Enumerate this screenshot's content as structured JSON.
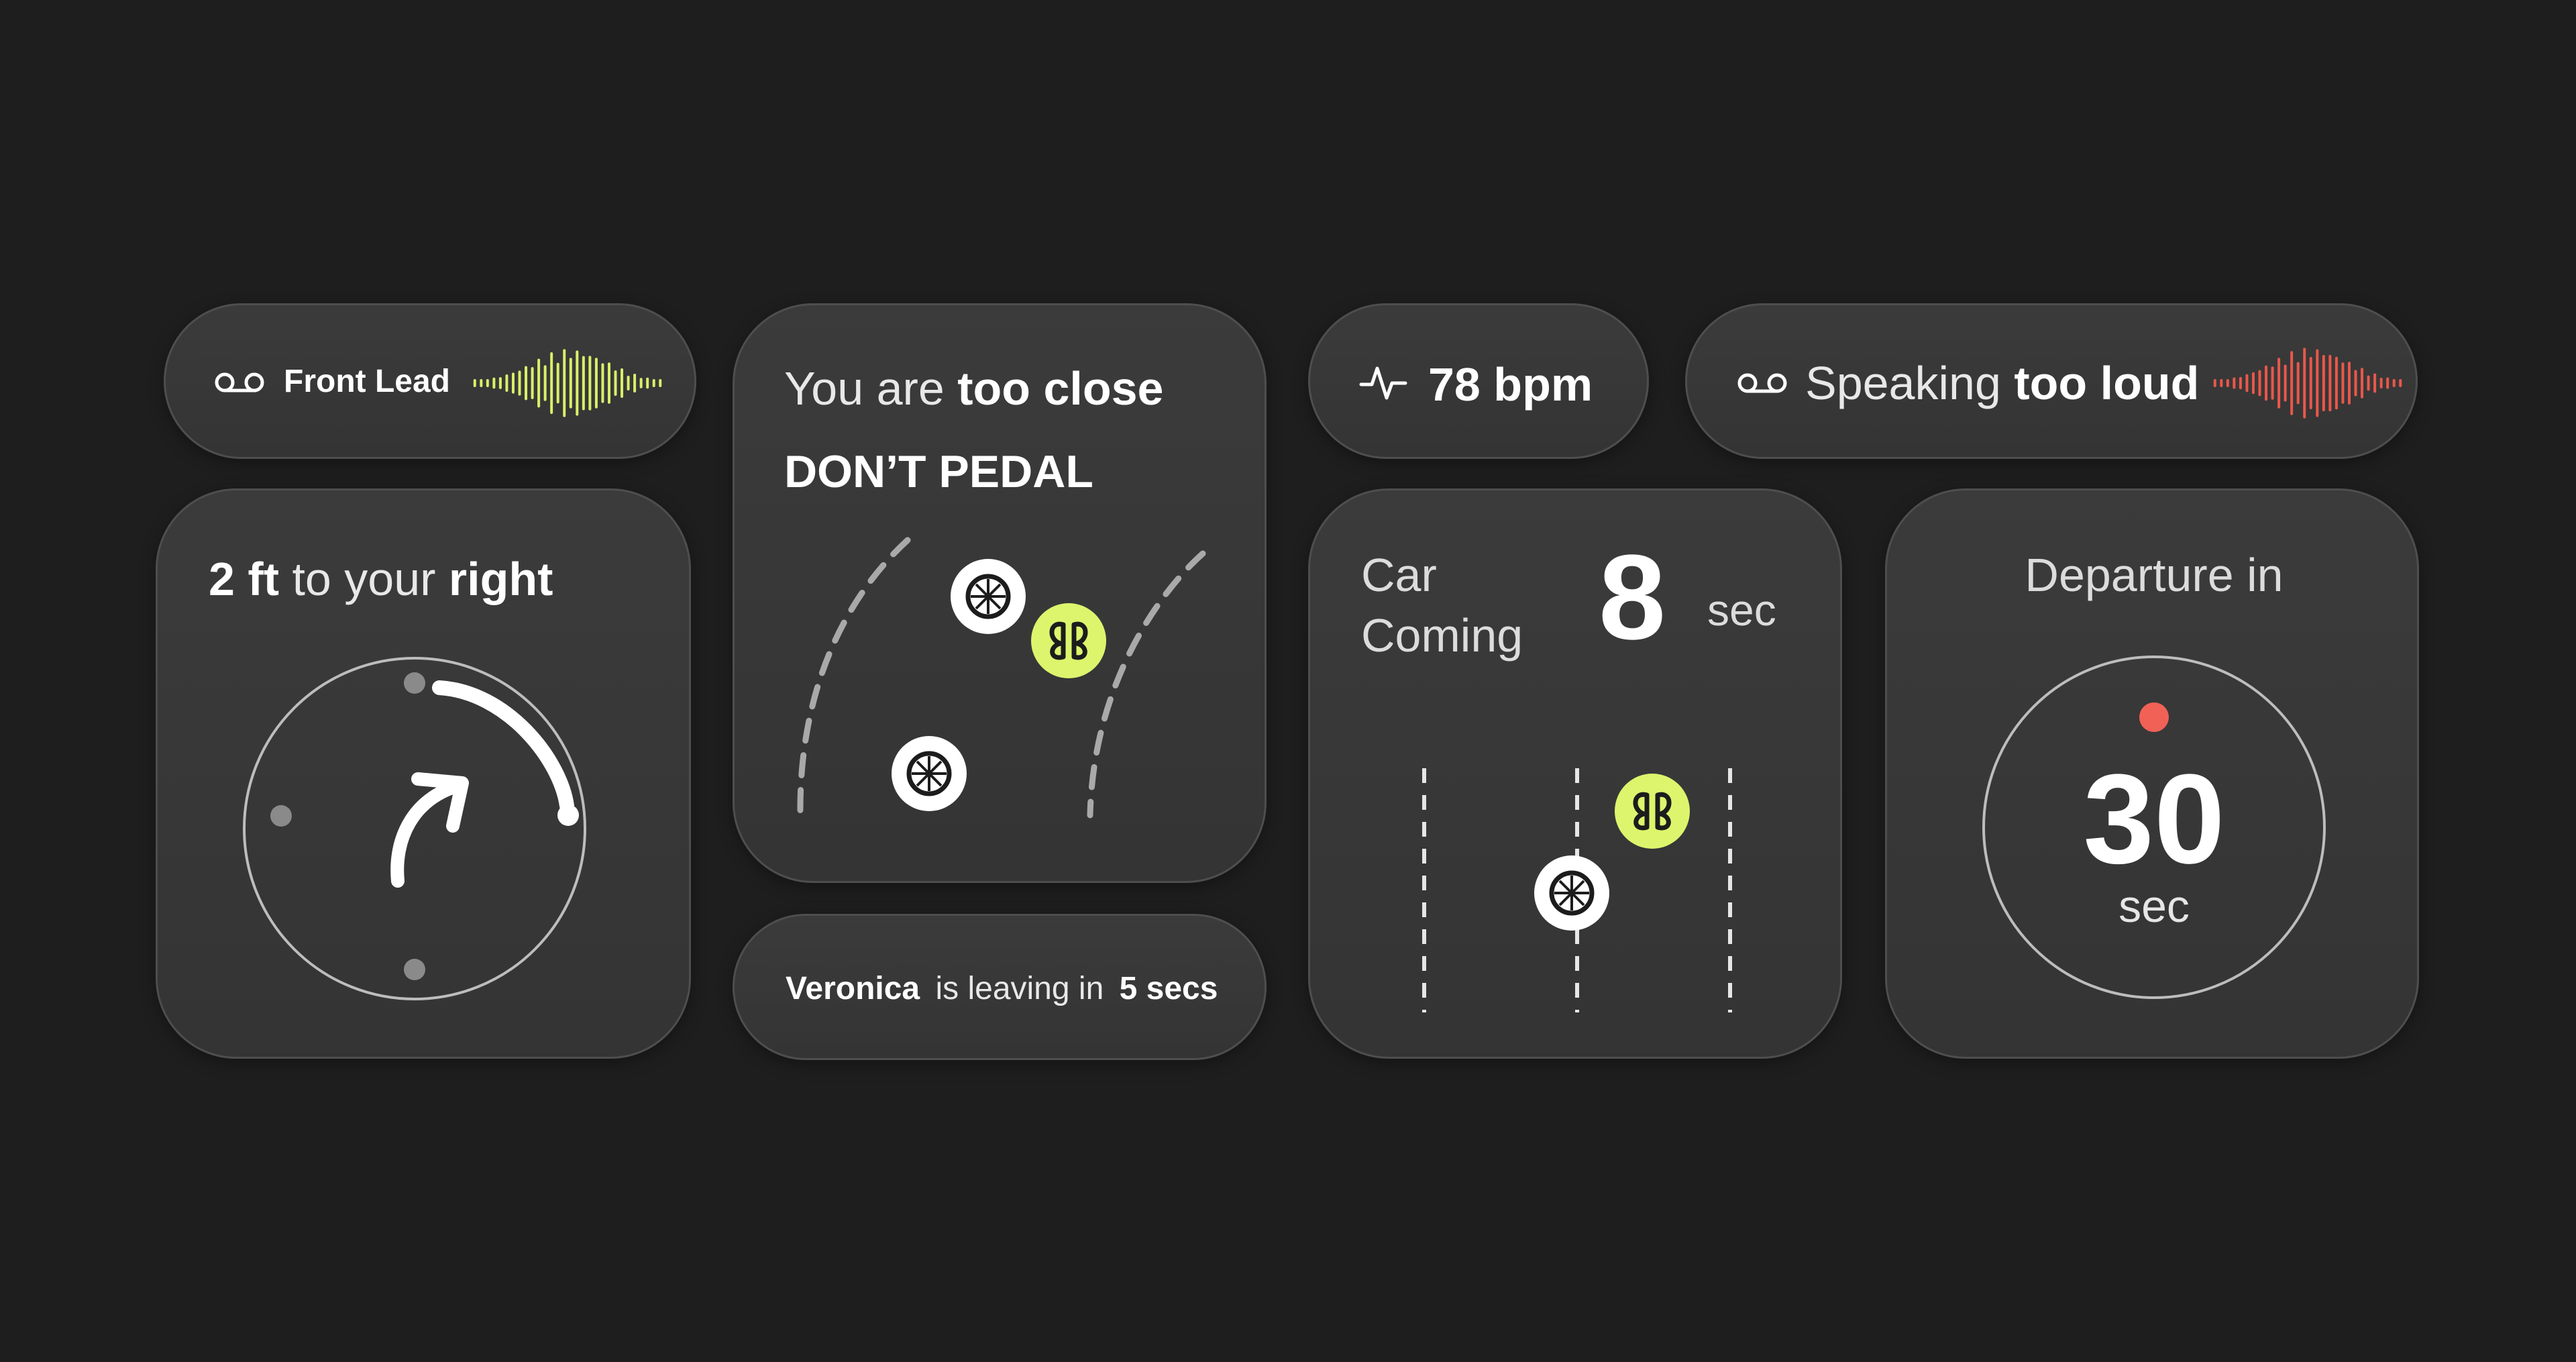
{
  "front_lead": {
    "label": "Front Lead",
    "icon": "voicemail-icon",
    "wave_color": "#d9ef6a"
  },
  "too_close": {
    "prefix": "You are",
    "emphasis": "too close",
    "instruction": "DON’T PEDAL",
    "icons": [
      "bike-wheel-icon",
      "bike-wheel-icon",
      "rider-badge-icon"
    ],
    "badge_color": "#dcf56d"
  },
  "heart_rate": {
    "icon": "heartbeat-icon",
    "value": "78 bpm"
  },
  "speaking": {
    "prefix": "Speaking",
    "emphasis": "too loud",
    "icon": "voicemail-icon",
    "wave_color": "#e8584b"
  },
  "direction": {
    "distance": "2 ft",
    "middle": "to your",
    "side": "right",
    "icon": "arrow-turn-right-icon"
  },
  "veronica": {
    "name": "Veronica",
    "middle": "is leaving in",
    "time": "5 secs"
  },
  "car_coming": {
    "line1": "Car",
    "line2": "Coming",
    "number": "8",
    "unit": "sec",
    "badge_color": "#dcf56d"
  },
  "departure": {
    "title": "Departure in",
    "number": "30",
    "unit": "sec",
    "dot_color": "#f26156"
  }
}
